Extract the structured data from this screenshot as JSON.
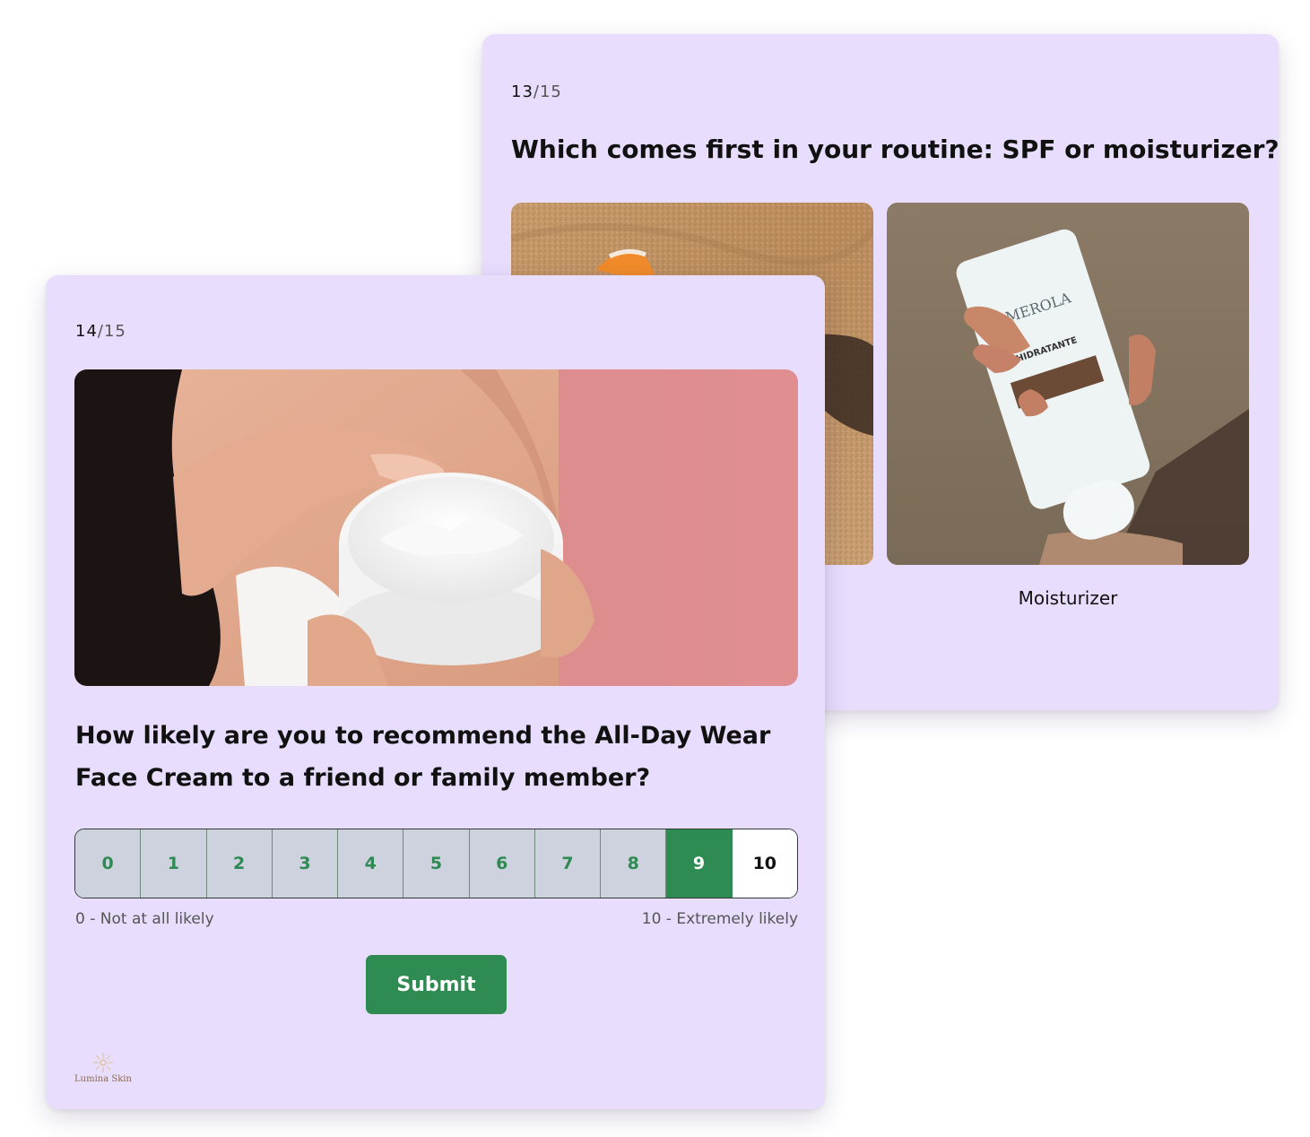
{
  "back_card": {
    "progress_current": "13",
    "progress_total": "/15",
    "question": "Which comes first in your routine: SPF or moisturizer?",
    "options": [
      {
        "label": "",
        "image": "spf-sunscreen-on-sand-photo"
      },
      {
        "label": "Moisturizer",
        "image": "moisturizer-tube-in-hand-photo"
      }
    ],
    "tube_brand": "SMEROLA",
    "tube_text": "HIDRATANTE"
  },
  "front_card": {
    "progress_current": "14",
    "progress_total": "/15",
    "hero_image": "face-cream-jar-in-hands-photo",
    "question": "How likely are you to recommend the All-Day Wear Face Cream to a friend or family member?",
    "scale": [
      "0",
      "1",
      "2",
      "3",
      "4",
      "5",
      "6",
      "7",
      "8",
      "9",
      "10"
    ],
    "selected_value": "9",
    "min_label": "0 - Not at all likely",
    "max_label": "10 - Extremely likely",
    "submit_label": "Submit",
    "brand_name": "Lumina Skin"
  },
  "colors": {
    "card_bg": "#e8ddfd",
    "accent_green": "#2e8b52",
    "scale_cell_bg": "#cdd2de"
  }
}
